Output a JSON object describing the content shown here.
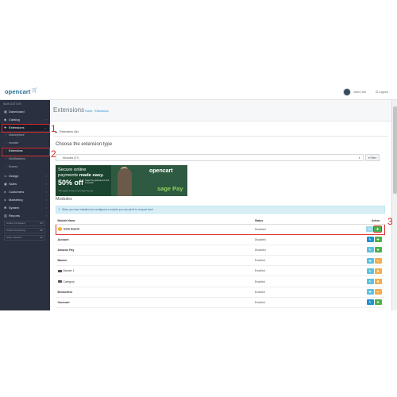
{
  "header": {
    "logo": "opencart",
    "logo_cart": "🛒",
    "user_name": "John Doe",
    "logout": "Logout"
  },
  "sidebar": {
    "title": "NAVIGATION",
    "items": [
      {
        "label": "Dashboard",
        "icon": "dashboard-icon"
      },
      {
        "label": "Catalog",
        "icon": "tag-icon"
      },
      {
        "label": "Extensions",
        "icon": "puzzle-icon"
      },
      {
        "label": "Marketplace"
      },
      {
        "label": "Installer"
      },
      {
        "label": "Extensions"
      },
      {
        "label": "Modifications"
      },
      {
        "label": "Events"
      },
      {
        "label": "Design",
        "icon": "monitor-icon"
      },
      {
        "label": "Sales",
        "icon": "cart-icon"
      },
      {
        "label": "Customers",
        "icon": "user-icon"
      },
      {
        "label": "Marketing",
        "icon": "share-icon"
      },
      {
        "label": "System",
        "icon": "gear-icon"
      },
      {
        "label": "Reports",
        "icon": "bar-chart-icon"
      }
    ],
    "stats": [
      {
        "label": "Orders Completed",
        "value": "0%"
      },
      {
        "label": "Orders Processing",
        "value": "0%"
      },
      {
        "label": "Other Statuses",
        "value": "0%"
      }
    ]
  },
  "main": {
    "title": "Extensions",
    "breadcrumb": [
      "Home",
      "Extensions"
    ],
    "panel_title": "Extension List",
    "choose_heading": "Choose the extension type",
    "select_value": "Modules (27)",
    "filter_label": "Filter",
    "banner": {
      "line1": "Secure online",
      "line2_pre": "payments",
      "line2_bold": "made easy.",
      "big": "50% off",
      "small": "Sage Pay gateway for first 3 months",
      "fine": "*Offer applies to Pay-in-stores/Sage Pay only",
      "brand": "opencart",
      "sage": "sage Pay"
    },
    "modules_heading": "Modules",
    "alert": "When you have installed and configured a module you can add it to a layout here!",
    "columns": [
      "Module Name",
      "Status",
      "Action"
    ],
    "rows": [
      {
        "name": "Geta Search",
        "status": "Disabled",
        "type": "highlight"
      },
      {
        "name": "Account",
        "status": "Disabled",
        "type": "install"
      },
      {
        "name": "Amazon Pay",
        "status": "Disabled",
        "type": "install"
      },
      {
        "name": "Banner",
        "status": "Enabled",
        "type": "parent"
      },
      {
        "name": "Banner 1",
        "status": "Enabled",
        "type": "child"
      },
      {
        "name": "Category",
        "status": "Enabled",
        "type": "child"
      },
      {
        "name": "Bestsellers",
        "status": "Enabled",
        "type": "parent"
      },
      {
        "name": "Carousel",
        "status": "Enabled",
        "type": "install"
      }
    ]
  },
  "annotations": [
    "1",
    "2",
    "3"
  ]
}
